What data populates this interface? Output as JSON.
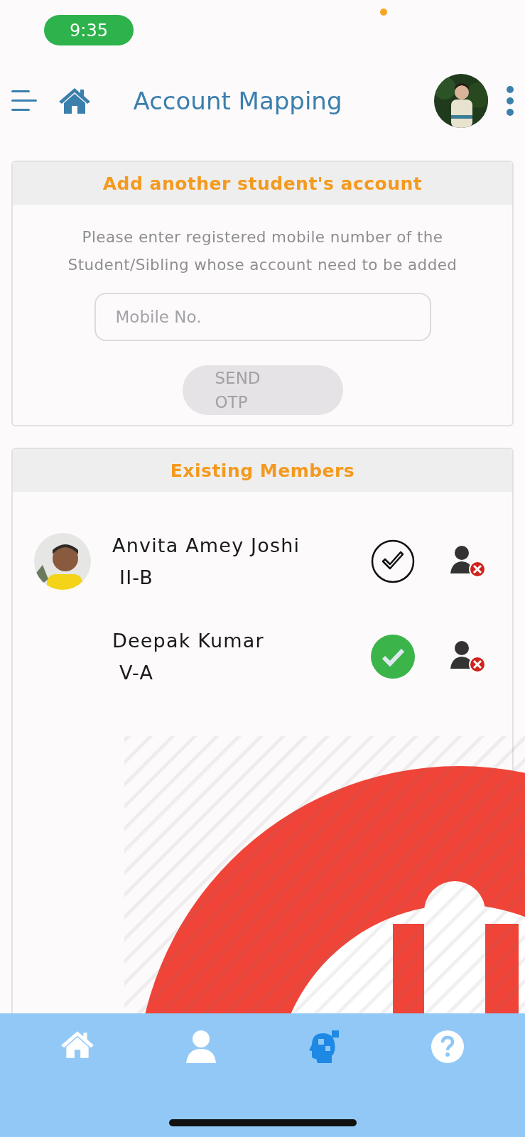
{
  "status_bar": {
    "time": "9:35"
  },
  "header": {
    "title": "Account Mapping"
  },
  "add_account": {
    "title": "Add another student's account",
    "instructions": "Please enter registered mobile number of the Student/Sibling whose account need to be added",
    "mobile_field": {
      "placeholder": "Mobile No."
    },
    "send_button": {
      "label": "SEND OTP",
      "disabled": true
    }
  },
  "members": {
    "title": "Existing Members",
    "items": [
      {
        "name": "Anvita Amey Joshi",
        "class": "II-B",
        "selected": false
      },
      {
        "name": "Deepak Kumar",
        "class": "V-A",
        "selected": true
      }
    ]
  },
  "bottom_nav": [
    {
      "kind": "home",
      "selected": false
    },
    {
      "kind": "profile",
      "selected": false
    },
    {
      "kind": "puzzle",
      "selected": true
    },
    {
      "kind": "help",
      "selected": false
    }
  ]
}
